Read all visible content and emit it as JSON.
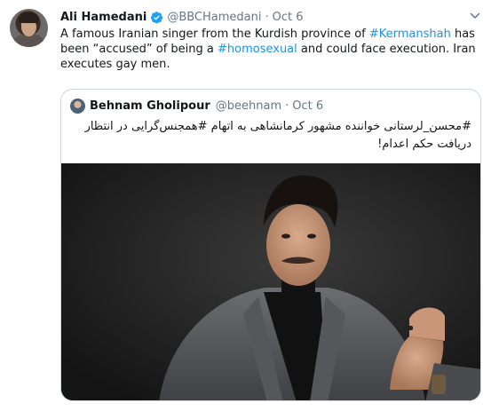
{
  "tweet": {
    "author_name": "Ali Hamedani",
    "author_handle": "@BBCHamedani",
    "separator": "·",
    "timestamp": "Oct 6",
    "verified": true,
    "text_parts": [
      "A famous Iranian singer from the Kurdish province of ",
      "#Kermanshah",
      " has been “accused” of being a ",
      "#homosexual",
      " and could face execution. Iran executes gay men."
    ],
    "link_color": "#1b95e0"
  },
  "quoted_tweet": {
    "author_name": "Behnam Gholipour",
    "author_handle": "@beehnam",
    "separator": "·",
    "timestamp": "Oct 6",
    "text": "#محسن_لرستانی خواننده مشهور کرمانشاهی به اتهام #همجنس‌گرایی در انتظار دریافت حکم اعدام!"
  },
  "icons": {
    "verified": "verified-badge-icon",
    "menu": "chevron-down-icon"
  },
  "colors": {
    "text": "#14171a",
    "secondary": "#657786",
    "border": "#ccd6dd",
    "accent": "#1b95e0"
  }
}
